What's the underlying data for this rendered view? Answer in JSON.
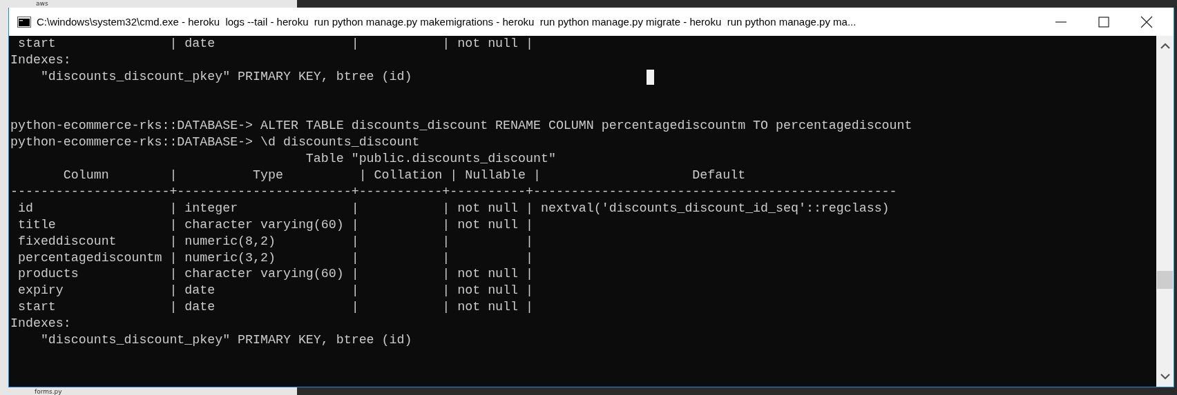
{
  "desktop": {
    "labels": [
      "aws",
      "forms.py"
    ]
  },
  "window": {
    "title": "C:\\windows\\system32\\cmd.exe - heroku  logs --tail - heroku  run python manage.py makemigrations - heroku  run python manage.py migrate - heroku  run python manage.py ma..."
  },
  "console": {
    "previous_output": [
      " start               | date                  |           | not null |",
      "Indexes:",
      "    \"discounts_discount_pkey\" PRIMARY KEY, btree (id)"
    ],
    "commands": [
      {
        "prompt": "python-ecommerce-rks::DATABASE->",
        "input": "ALTER TABLE discounts_discount RENAME COLUMN percentagediscountm TO percentagediscount"
      },
      {
        "prompt": "python-ecommerce-rks::DATABASE->",
        "input": "\\d discounts_discount"
      }
    ],
    "table_title": "                                       Table \"public.discounts_discount\"",
    "table_header": "       Column        |          Type          | Collation | Nullable |                    Default",
    "table_rule": "---------------------+-----------------------+-----------+----------+------------------------------------------------",
    "table_rows": [
      " id                  | integer               |           | not null | nextval('discounts_discount_id_seq'::regclass)",
      " title               | character varying(60) |           | not null |",
      " fixeddiscount       | numeric(8,2)          |           |          |",
      " percentagediscountm | numeric(3,2)          |           |          |",
      " products            | character varying(60) |           | not null |",
      " expiry              | date                  |           | not null |",
      " start               | date                  |           | not null |"
    ],
    "footer": [
      "Indexes:",
      "    \"discounts_discount_pkey\" PRIMARY KEY, btree (id)"
    ]
  }
}
